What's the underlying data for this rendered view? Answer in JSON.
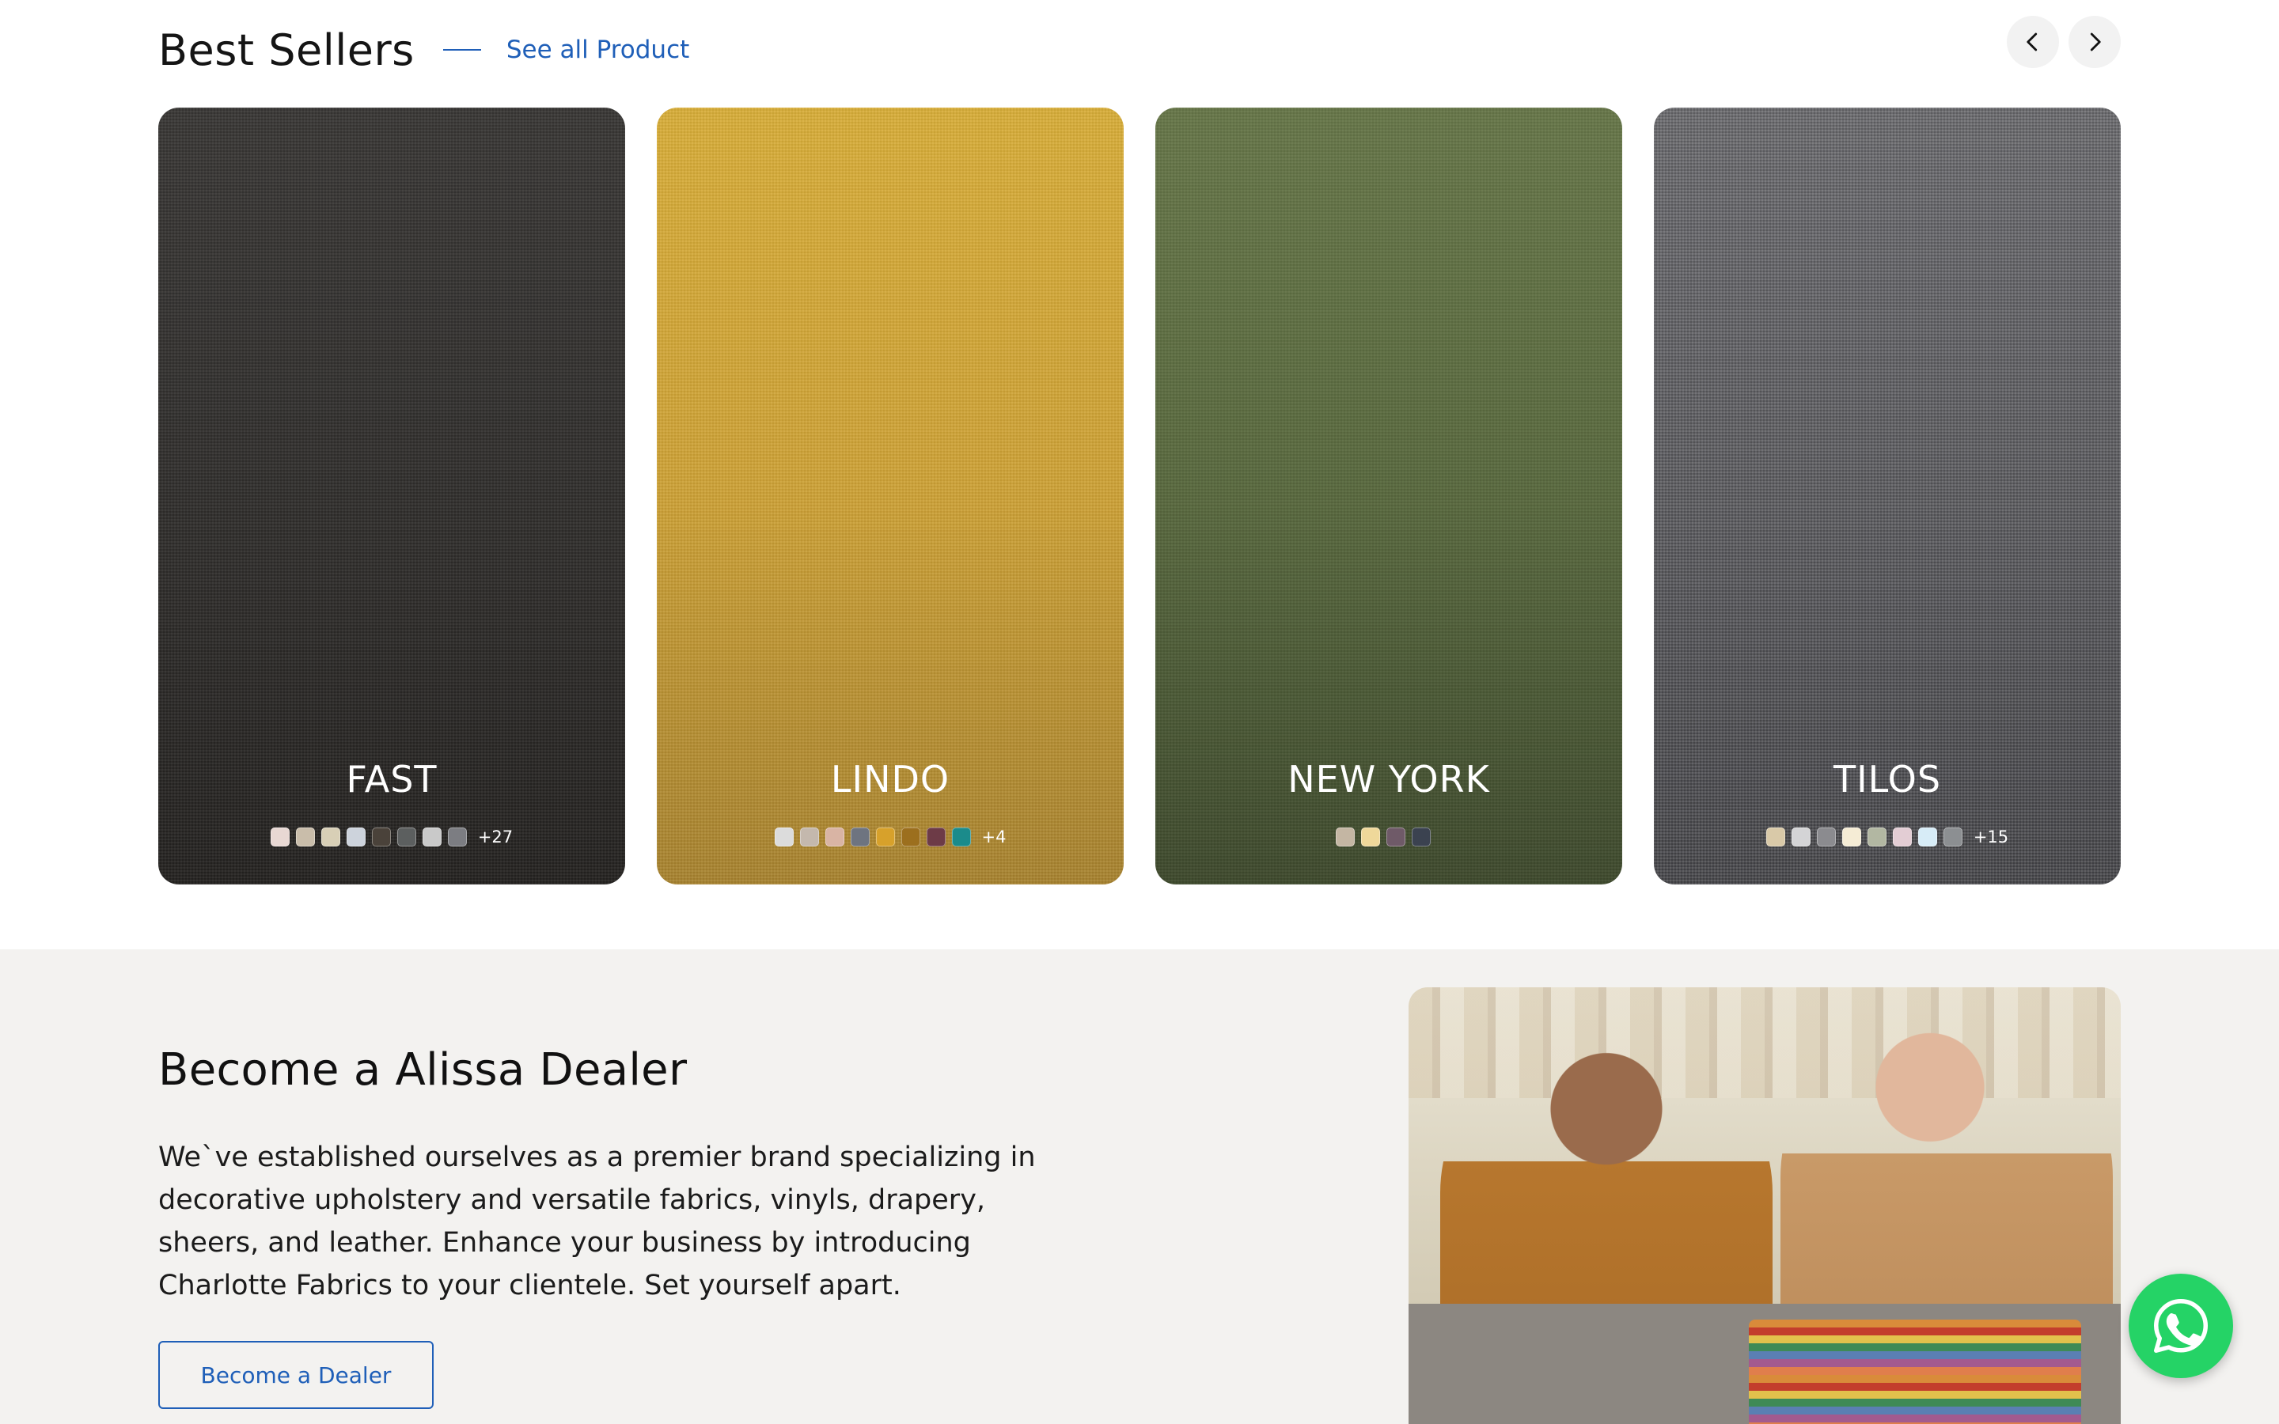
{
  "best_sellers": {
    "title": "Best Sellers",
    "see_all_label": "See all Product",
    "prev_icon": "chevron-left-icon",
    "next_icon": "chevron-right-icon",
    "products": [
      {
        "name": "FAST",
        "more": "+27",
        "swatches": [
          "#e8d8d3",
          "#c9bdaa",
          "#d8cfb6",
          "#cdd3dc",
          "#4a423a",
          "#5c5f5f",
          "#c9c9c9",
          "#7c7d82"
        ]
      },
      {
        "name": "LINDO",
        "more": "+4",
        "swatches": [
          "#dcdcdc",
          "#c4b8ad",
          "#d9b4a4",
          "#6e7480",
          "#d7a12b",
          "#9c6f1e",
          "#6d3b47",
          "#1b8b8b"
        ]
      },
      {
        "name": "NEW YORK",
        "more": "",
        "swatches": [
          "#c4b6a3",
          "#efd89a",
          "#6f5a68",
          "#3b4250"
        ]
      },
      {
        "name": "TILOS",
        "more": "+15",
        "swatches": [
          "#d9c9a8",
          "#d4d4d6",
          "#8b8b8f",
          "#f5ecd5",
          "#b2b7a2",
          "#e3cdd4",
          "#d7ecf7",
          "#8c8f92"
        ]
      }
    ]
  },
  "dealer": {
    "title": "Become a Alissa Dealer",
    "text": "We`ve established ourselves as a premier brand specializing in decorative upholstery and versatile fabrics, vinyls, drapery, sheers, and leather. Enhance your business by introducing Charlotte Fabrics to your clientele. Set yourself apart.",
    "button_label": "Become a Dealer"
  },
  "floating": {
    "whatsapp_icon": "whatsapp-icon",
    "color": "#25d366"
  },
  "colors": {
    "accent": "#1f5fb8",
    "section_bg": "#f3f2f0"
  }
}
